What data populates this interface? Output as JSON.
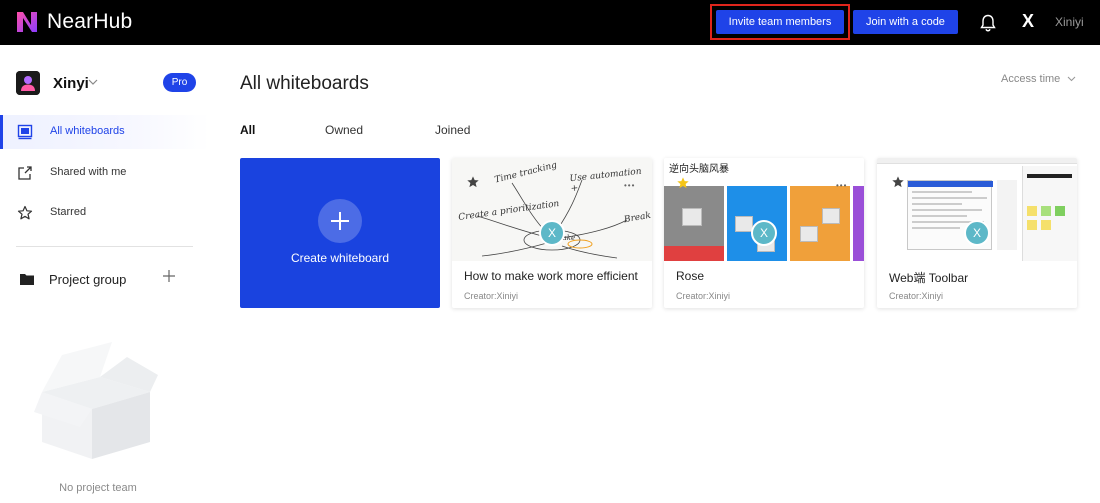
{
  "header": {
    "brand": "NearHub",
    "invite_label": "Invite team members",
    "join_label": "Join with a code",
    "avatar_initial": "X",
    "username": "Xiniyi"
  },
  "sidebar": {
    "user_name": "Xinyi",
    "plan_badge": "Pro",
    "items": [
      {
        "label": "All whiteboards",
        "icon": "whiteboard-icon",
        "active": true
      },
      {
        "label": "Shared with me",
        "icon": "share-icon",
        "active": false
      },
      {
        "label": "Starred",
        "icon": "star-icon",
        "active": false
      }
    ],
    "project_group_label": "Project group",
    "empty_text": "No project team"
  },
  "main": {
    "title": "All whiteboards",
    "sort_label": "Access time",
    "tabs": [
      {
        "label": "All",
        "active": true
      },
      {
        "label": "Owned",
        "active": false
      },
      {
        "label": "Joined",
        "active": false
      }
    ],
    "create_label": "Create whiteboard",
    "boards": [
      {
        "title": "How to make work more efficient",
        "creator": "Creator:Xiniyi",
        "avatar": "X",
        "thumb_text": [
          "Time tracking",
          "Use automation +",
          "Create a prioritization",
          "Break",
          "make"
        ]
      },
      {
        "title": "Rose",
        "creator": "Creator:Xiniyi",
        "avatar": "X",
        "thumb_text": [
          "逆向头脑风暴"
        ]
      },
      {
        "title": "Web端 Toolbar",
        "creator": "Creator:Xiniyi",
        "avatar": "X",
        "thumb_text": []
      }
    ]
  },
  "colors": {
    "brand_blue": "#1f43e8",
    "highlight_red": "#e0251c",
    "topbar_bg": "#000000",
    "avatar_teal": "#5db8c8"
  }
}
